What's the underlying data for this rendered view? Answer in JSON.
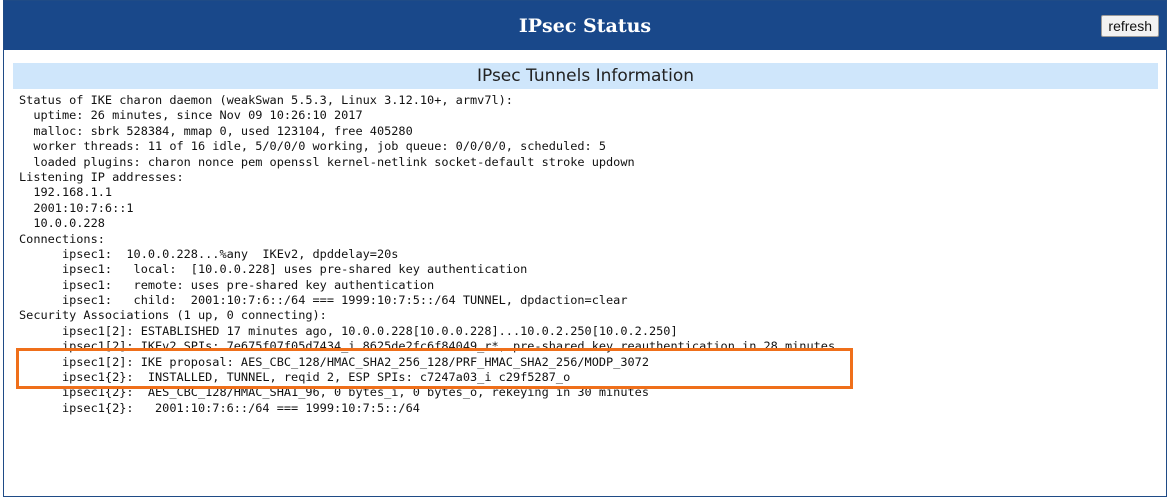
{
  "header": {
    "title": "IPsec Status",
    "refresh_label": "refresh"
  },
  "section": {
    "title": "IPsec Tunnels Information"
  },
  "log_lines": [
    "Status of IKE charon daemon (weakSwan 5.5.3, Linux 3.12.10+, armv7l):",
    "  uptime: 26 minutes, since Nov 09 10:26:10 2017",
    "  malloc: sbrk 528384, mmap 0, used 123104, free 405280",
    "  worker threads: 11 of 16 idle, 5/0/0/0 working, job queue: 0/0/0/0, scheduled: 5",
    "  loaded plugins: charon nonce pem openssl kernel-netlink socket-default stroke updown",
    "Listening IP addresses:",
    "  192.168.1.1",
    "  2001:10:7:6::1",
    "  10.0.0.228",
    "Connections:",
    "      ipsec1:  10.0.0.228...%any  IKEv2, dpddelay=20s",
    "      ipsec1:   local:  [10.0.0.228] uses pre-shared key authentication",
    "      ipsec1:   remote: uses pre-shared key authentication",
    "      ipsec1:   child:  2001:10:7:6::/64 === 1999:10:7:5::/64 TUNNEL, dpdaction=clear",
    "Security Associations (1 up, 0 connecting):",
    "      ipsec1[2]: ESTABLISHED 17 minutes ago, 10.0.0.228[10.0.0.228]...10.0.2.250[10.0.2.250]",
    "      ipsec1[2]: IKEv2 SPIs: 7e675f07f05d7434_i 8625de2fc6f84049_r*, pre-shared key reauthentication in 28 minutes",
    "      ipsec1[2]: IKE proposal: AES_CBC_128/HMAC_SHA2_256_128/PRF_HMAC_SHA2_256/MODP_3072",
    "      ipsec1{2}:  INSTALLED, TUNNEL, reqid 2, ESP SPIs: c7247a03_i c29f5287_o",
    "      ipsec1{2}:  AES_CBC_128/HMAC_SHA1_96, 0 bytes_i, 0 bytes_o, rekeying in 30 minutes",
    "      ipsec1{2}:   2001:10:7:6::/64 === 1999:10:7:5::/64"
  ],
  "colors": {
    "header_bg": "#19488a",
    "section_bg": "#cfe6fb",
    "highlight": "#ef6f1a"
  }
}
